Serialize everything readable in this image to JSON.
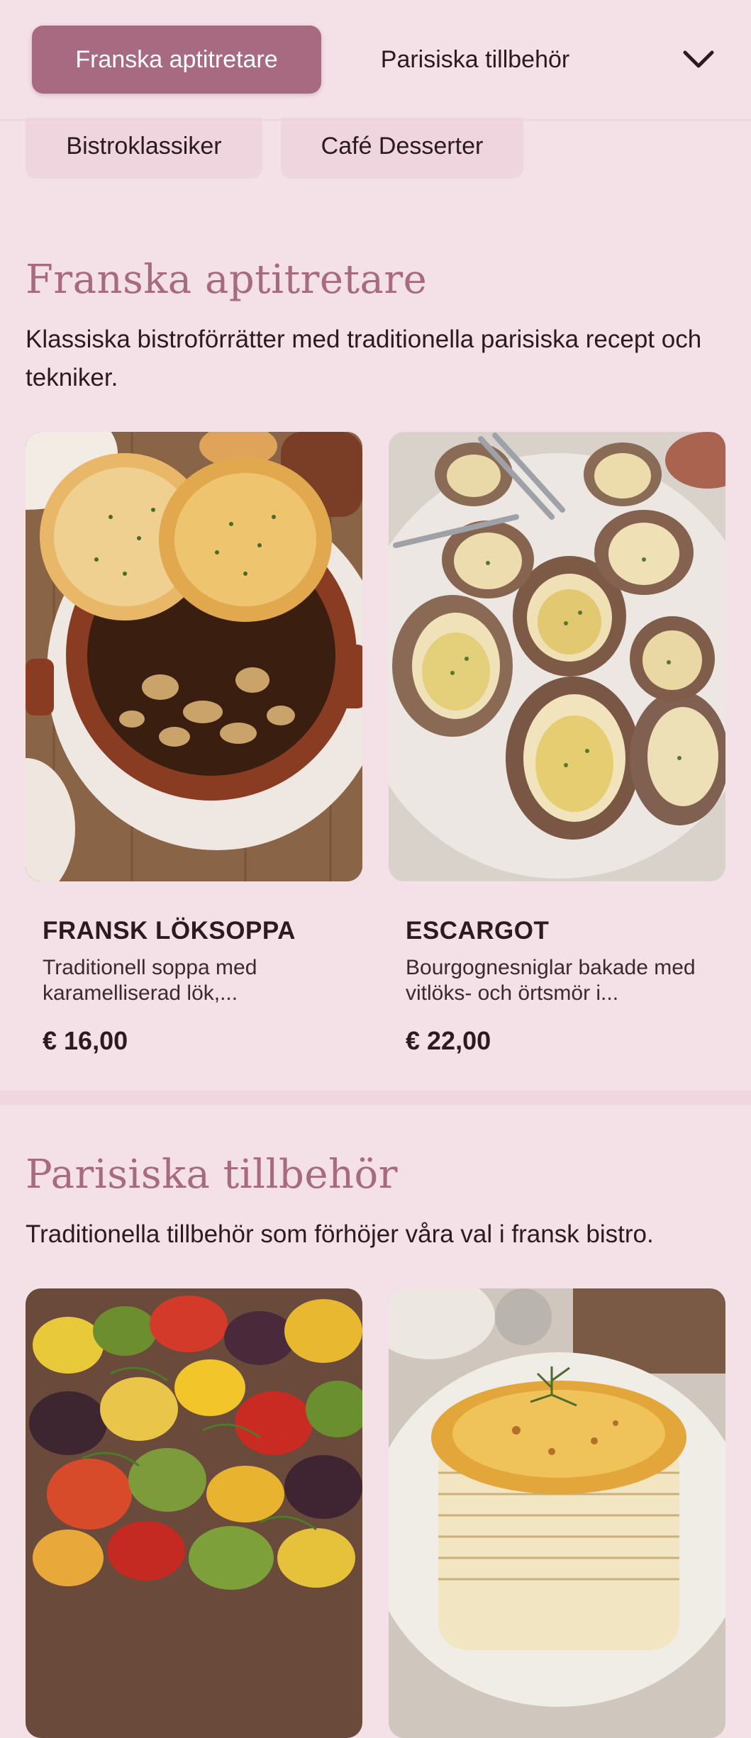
{
  "nav": {
    "active_category": "Franska aptitretare",
    "categories": [
      "Parisiska tillbehör",
      "Bistroklassiker",
      "Café Desserter"
    ],
    "expand_icon": "chevron-down-icon"
  },
  "sections": [
    {
      "title": "Franska aptitretare",
      "description": "Klassiska bistroförrätter med traditionella parisiska recept och tekniker.",
      "items": [
        {
          "name": "FRANSK LÖKSOPPA",
          "description": "Traditionell soppa med karamelliserad lök,...",
          "price": "€ 16,00",
          "image": "french-onion-soup-photo"
        },
        {
          "name": "ESCARGOT",
          "description": "Bourgognesniglar bakade med vitlöks- och örtsmör i...",
          "price": "€ 22,00",
          "image": "escargot-photo"
        }
      ]
    },
    {
      "title": "Parisiska tillbehör",
      "description": "Traditionella tillbehör som förhöjer våra val i fransk bistro.",
      "items": [
        {
          "image": "ratatouille-vegetables-photo"
        },
        {
          "image": "potato-gratin-photo"
        }
      ]
    }
  ],
  "colors": {
    "background": "#f4e0e7",
    "accent": "#a86a80",
    "text": "#2b1a1f"
  }
}
